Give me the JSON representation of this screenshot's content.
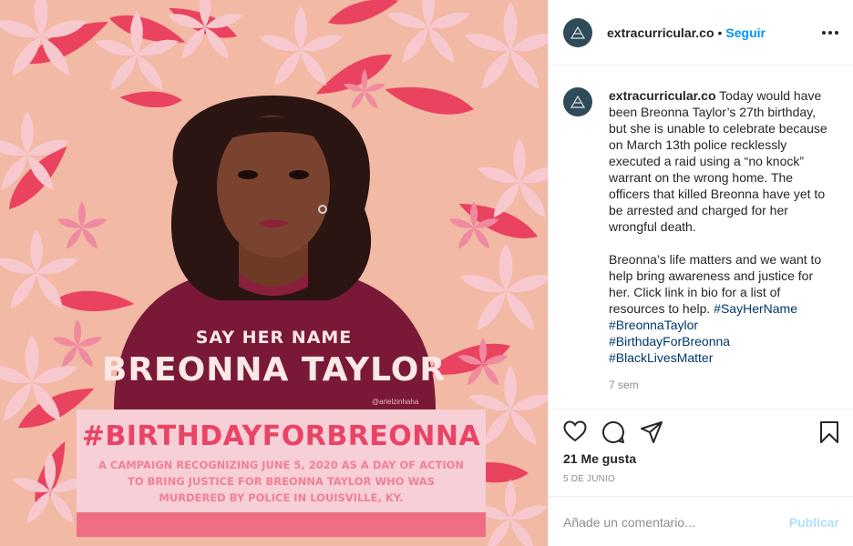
{
  "post_image": {
    "say_her_name": "SAY HER NAME",
    "name": "BREONNA TAYLOR",
    "artist_credit": "@arielzinhaha",
    "hashtag": "#BIRTHDAYFORBREONNA",
    "campaign_lines": [
      "A CAMPAIGN RECOGNIZING JUNE 5, 2020 AS A DAY OF ACTION",
      "TO BRING JUSTICE FOR BREONNA TAYLOR WHO WAS",
      "MURDERED BY POLICE IN LOUISVILLE, KY."
    ],
    "colors": {
      "background": "#f2b9a5",
      "flower_red": "#e9435f",
      "flower_pink": "#f7c9cf",
      "shirt": "#7a1838",
      "banner": "#f7cfd6",
      "banner_text": "#e94466"
    }
  },
  "header": {
    "username": "extracurricular.co",
    "separator": "•",
    "follow_label": "Seguir",
    "avatar_icon": "triangle-logo-icon",
    "more_icon": "more-options-icon"
  },
  "caption": {
    "username": "extracurricular.co",
    "paragraph1": " Today would have been Breonna Taylor’s 27th birthday, but she is unable to celebrate because on March 13th police recklessly executed a raid using a “no knock” warrant on the wrong home. The officers that killed Breonna have yet to be arrested and charged for her wrongful death.",
    "paragraph2": "Breonna’s life matters and we want to help bring awareness and justice for her. Click link in bio for a list of resources to help. ",
    "hashtags": [
      "#SayHerName",
      "#BreonnaTaylor",
      "#BirthdayForBreonna",
      "#BlackLivesMatter"
    ],
    "time_ago": "7 sem"
  },
  "actions": {
    "like_icon": "heart-icon",
    "comment_icon": "comment-icon",
    "share_icon": "share-icon",
    "save_icon": "bookmark-icon",
    "likes": "21 Me gusta",
    "date": "5 DE JUNIO"
  },
  "comment": {
    "placeholder": "Añade un comentario...",
    "publish_label": "Publicar"
  },
  "colors": {
    "accent": "#0095f6",
    "hashtag": "#00376b",
    "muted": "#8e8e8e",
    "publish_disabled": "#b2dffc"
  }
}
